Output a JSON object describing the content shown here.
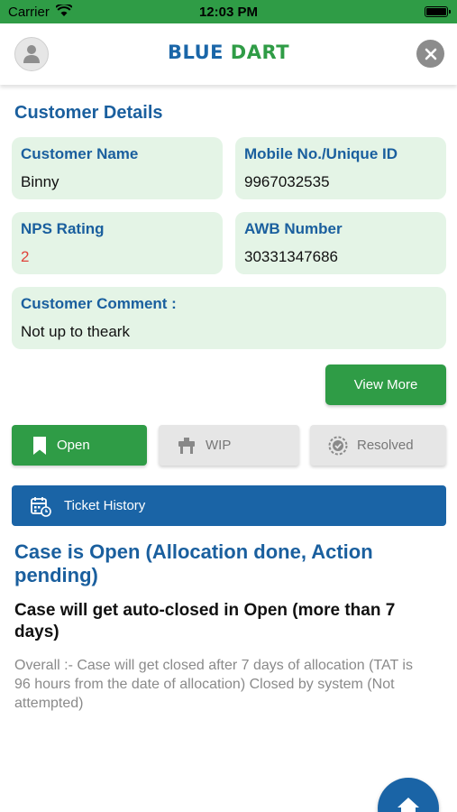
{
  "status_bar": {
    "carrier": "Carrier",
    "time": "12:03 PM",
    "wifi_icon": "wifi-icon",
    "battery_icon": "battery-icon"
  },
  "header": {
    "brand_word1": "BLUE",
    "brand_word2": "DART",
    "avatar_icon": "user-avatar-icon",
    "close_icon": "close-icon"
  },
  "customer_details": {
    "title": "Customer Details",
    "name_label": "Customer Name",
    "name_value": "Binny",
    "mobile_label": "Mobile No./Unique ID",
    "mobile_value": "9967032535",
    "nps_label": "NPS Rating",
    "nps_value": "2",
    "awb_label": "AWB Number",
    "awb_value": "30331347686",
    "comment_label": "Customer Comment :",
    "comment_value": "Not up to theark"
  },
  "view_more_label": "View More",
  "tabs": [
    {
      "label": "Open",
      "icon": "bookmark-icon",
      "active": true
    },
    {
      "label": "WIP",
      "icon": "work-in-progress-icon",
      "active": false
    },
    {
      "label": "Resolved",
      "icon": "resolved-badge-icon",
      "active": false
    }
  ],
  "ticket_history_label": "Ticket History",
  "case": {
    "title": "Case is Open (Allocation done, Action pending)",
    "subtitle": "Case will get auto-closed in Open (more than 7 days)",
    "description": "Overall :- Case will get closed after 7 days of allocation (TAT is 96 hours from the date of allocation) Closed by system (Not attempted)"
  },
  "colors": {
    "brand_blue": "#1a66a8",
    "brand_green": "#2f9c46",
    "card_bg": "#e4f4e6",
    "nps_red": "#e0433b"
  }
}
